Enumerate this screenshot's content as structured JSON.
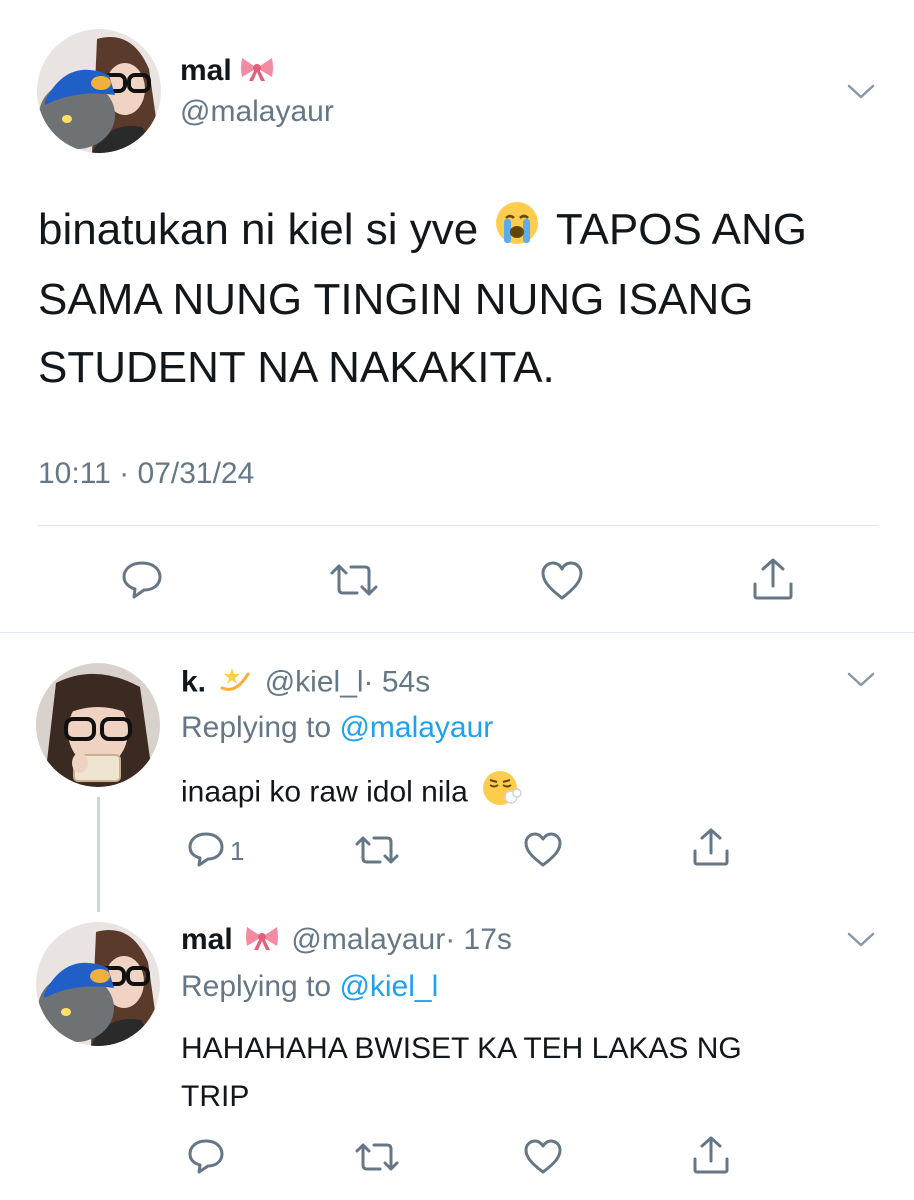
{
  "main_tweet": {
    "name": "mal",
    "name_emoji": "ribbon-emoji",
    "handle": "@malayaur",
    "text_part1": "binatukan ni kiel si yve",
    "text_emoji": "loudly-crying-face-emoji",
    "text_part2": "TAPOS ANG",
    "text_line2": "SAMA NUNG TINGIN NUNG ISANG",
    "text_line3": "STUDENT NA NAKAKITA.",
    "timestamp": "10:11 · 07/31/24"
  },
  "reply1": {
    "name": "k.",
    "name_emoji": "dizzy-emoji",
    "handle": "@kiel_l",
    "time": "· 54s",
    "replying_prefix": "Replying to",
    "replying_to": "@malayaur",
    "text": "inaapi ko raw idol nila",
    "text_emoji": "face-exhaling-emoji",
    "reply_count": "1"
  },
  "reply2": {
    "name": "mal",
    "name_emoji": "ribbon-emoji",
    "handle": "@malayaur",
    "time": "· 17s",
    "replying_prefix": "Replying to",
    "replying_to": "@kiel_l",
    "text_line1": "HAHAHAHA BWISET KA TEH LAKAS NG",
    "text_line2": "TRIP"
  },
  "colors": {
    "text": "#14171a",
    "secondary": "#657786",
    "link": "#1da1f2",
    "divider": "#e1e8ed"
  }
}
